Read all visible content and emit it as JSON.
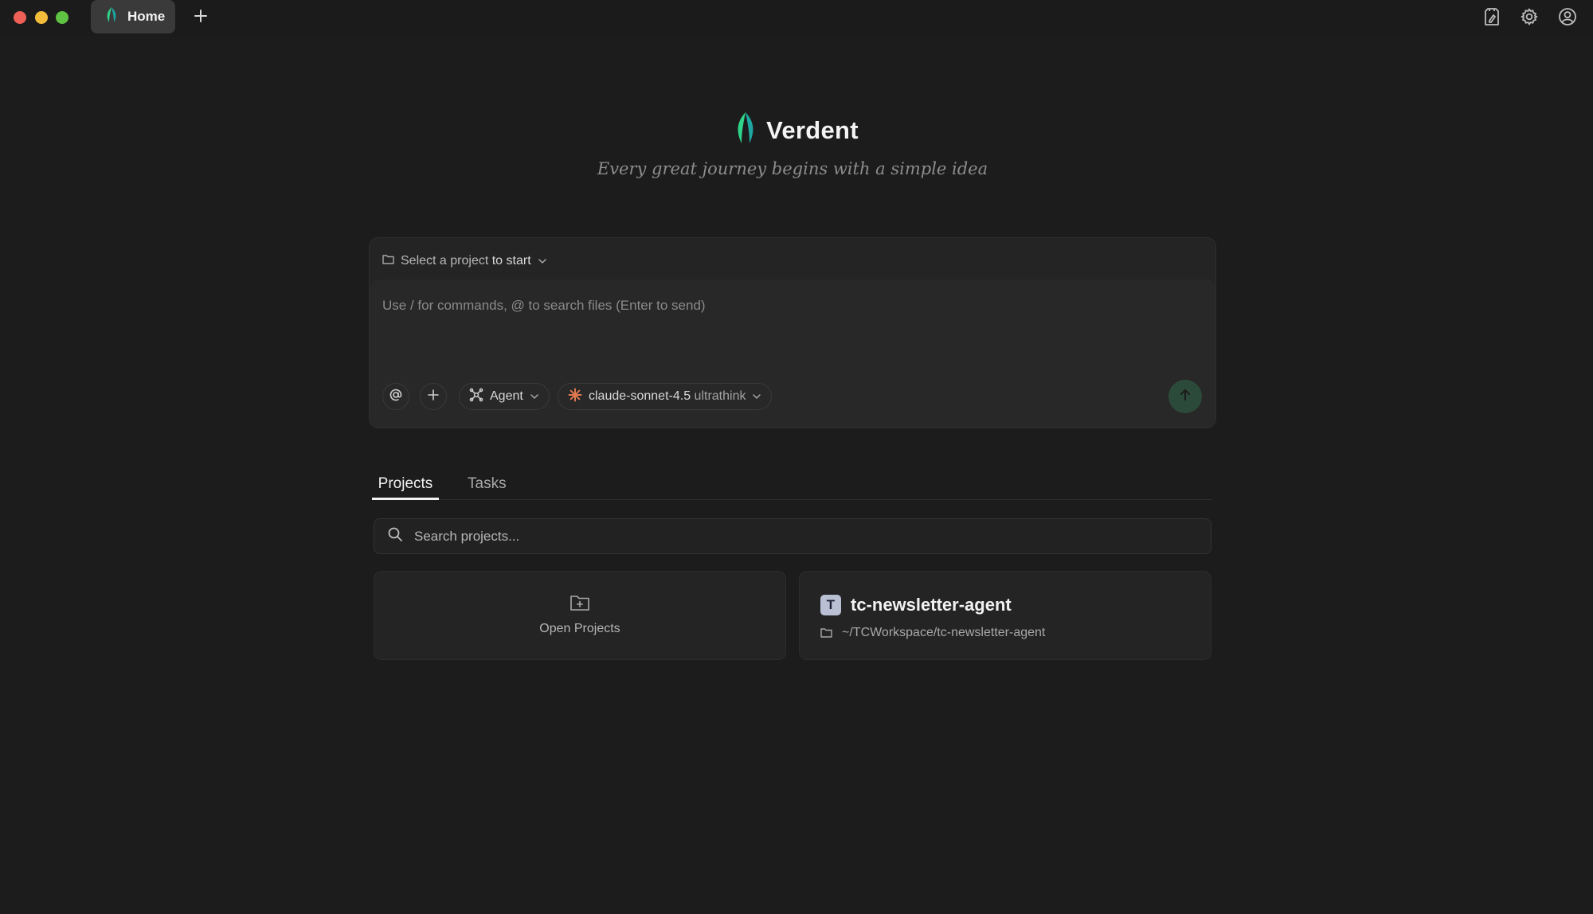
{
  "titlebar": {
    "tabs": [
      {
        "label": "Home"
      }
    ],
    "new_tab_icon": "plus-icon",
    "right_icons": [
      "notes-icon",
      "gear-icon",
      "user-icon"
    ]
  },
  "brand": {
    "name": "Verdent",
    "tagline": "Every great journey begins with a simple idea",
    "logo_icon": "leaf-logo-icon"
  },
  "composer": {
    "project_select_prefix": "Select a project",
    "project_select_suffix": " to start",
    "placeholder": "Use / for commands, @ to search files (Enter to send)",
    "mode_label": "Agent",
    "model_label": "claude-sonnet-4.5",
    "model_option": "ultrathink"
  },
  "tabs": [
    {
      "label": "Projects",
      "active": true
    },
    {
      "label": "Tasks",
      "active": false
    }
  ],
  "search": {
    "placeholder": "Search projects..."
  },
  "cards": {
    "open_label": "Open Projects",
    "project": {
      "initial": "T",
      "name": "tc-newsletter-agent",
      "path": "~/TCWorkspace/tc-newsletter-agent"
    }
  },
  "colors": {
    "background": "#1c1c1c",
    "brand_green": "#2fd58a",
    "brand_teal": "#1ea7a0",
    "send_button": "#2c4a3a",
    "avatar_bg": "#b9c0d4"
  }
}
